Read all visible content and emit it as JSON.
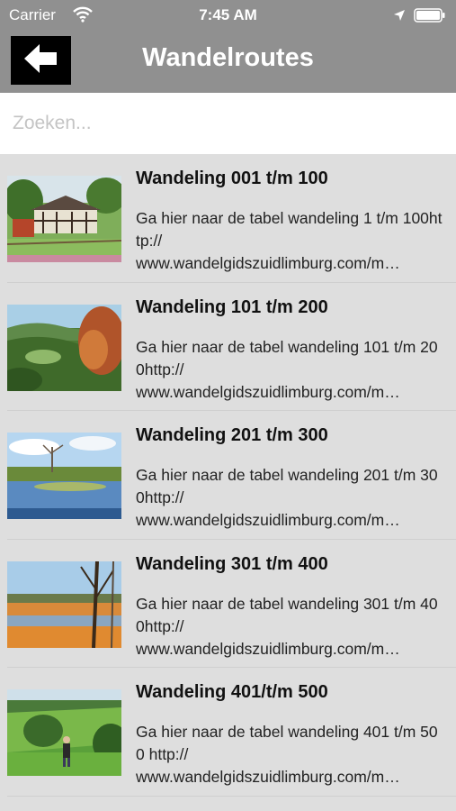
{
  "status_bar": {
    "carrier": "Carrier",
    "time": "7:45 AM"
  },
  "nav": {
    "title": "Wandelroutes",
    "back_icon": "arrow-left-icon"
  },
  "search": {
    "placeholder": "Zoeken..."
  },
  "routes": [
    {
      "title": "Wandeling 001 t/m 100",
      "description": "Ga hier naar de tabel wandeling 1 t/m 100http://\nwww.wandelgidszuidlimburg.com/m…",
      "image": "timber-farmhouse"
    },
    {
      "title": "Wandeling 101 t/m 200",
      "description": "Ga hier naar de tabel wandeling 101 t/m 200http://\nwww.wandelgidszuidlimburg.com/m…",
      "image": "autumn-valley"
    },
    {
      "title": "Wandeling 201 t/m 300",
      "description": "Ga hier naar de tabel wandeling 201 t/m 300http://\nwww.wandelgidszuidlimburg.com/m…",
      "image": "pond-reflection"
    },
    {
      "title": "Wandeling 301 t/m 400",
      "description": "Ga hier naar de tabel wandeling 301 t/m 400http://\nwww.wandelgidszuidlimburg.com/m…",
      "image": "heath-sunset"
    },
    {
      "title": "Wandeling 401/t/m 500",
      "description": "Ga hier naar de tabel wandeling 401 t/m 500 http://\nwww.wandelgidszuidlimburg.com/m…",
      "image": "hiker-meadow"
    }
  ]
}
